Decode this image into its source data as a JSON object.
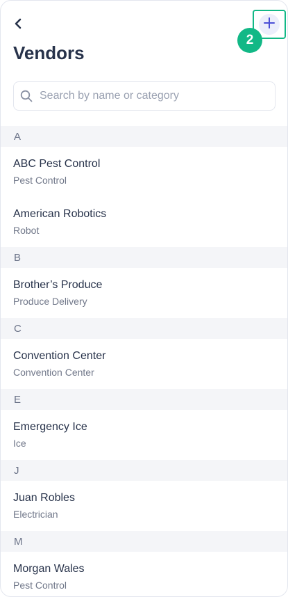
{
  "header": {
    "title": "Vendors",
    "add_badge": "2"
  },
  "search": {
    "placeholder": "Search by name or category"
  },
  "icons": {
    "back": "chevron-left-icon",
    "add": "plus-icon",
    "search": "search-icon"
  },
  "colors": {
    "accent": "#12b886",
    "title": "#27324a",
    "section_bg": "#f4f5f8",
    "add_button_bg": "#eceefb",
    "add_button_icon": "#4b4fd6"
  },
  "sections": [
    {
      "letter": "A",
      "items": [
        {
          "name": "ABC Pest Control",
          "category": "Pest Control"
        },
        {
          "name": "American Robotics",
          "category": "Robot"
        }
      ]
    },
    {
      "letter": "B",
      "items": [
        {
          "name": "Brother’s Produce",
          "category": "Produce Delivery"
        }
      ]
    },
    {
      "letter": "C",
      "items": [
        {
          "name": "Convention Center",
          "category": "Convention Center"
        }
      ]
    },
    {
      "letter": "E",
      "items": [
        {
          "name": "Emergency Ice",
          "category": "Ice"
        }
      ]
    },
    {
      "letter": "J",
      "items": [
        {
          "name": "Juan Robles",
          "category": "Electrician"
        }
      ]
    },
    {
      "letter": "M",
      "items": [
        {
          "name": "Morgan Wales",
          "category": "Pest Control"
        }
      ]
    }
  ]
}
